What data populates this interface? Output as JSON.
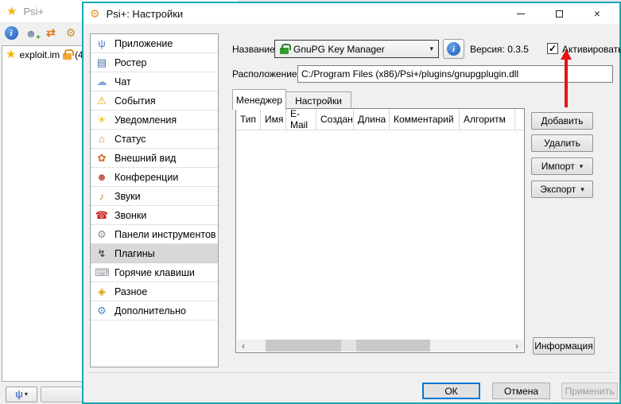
{
  "colors": {
    "dialog_border": "#15aab5",
    "focus_accent": "#0078d7",
    "annotation_arrow": "#e81414",
    "selection_bg": "#d8d8d8"
  },
  "background_window": {
    "title": "Psi+",
    "star_glyph": "★",
    "toolbar": {
      "info_glyph": "i",
      "add_contact_glyph": "☻",
      "transfer_glyph": "⇄",
      "wrench_glyph": "⚙"
    },
    "roster": {
      "star_glyph": "★",
      "account": "exploit.im",
      "suffix": "(4"
    },
    "status_button": {
      "psi_glyph": "ψ",
      "caret": "▾"
    }
  },
  "dialog": {
    "title": "Psi+: Настройки",
    "title_icon_glyph": "⚙",
    "sidebar": {
      "items": [
        {
          "label": "Приложение",
          "icon": "application-icon",
          "glyph": "ψ",
          "color": "#4f7bd9"
        },
        {
          "label": "Ростер",
          "icon": "roster-icon",
          "glyph": "▤",
          "color": "#4a6fa5"
        },
        {
          "label": "Чат",
          "icon": "chat-icon",
          "glyph": "☁",
          "color": "#79a8d8"
        },
        {
          "label": "События",
          "icon": "events-icon",
          "glyph": "⚠",
          "color": "#f0a000"
        },
        {
          "label": "Уведомления",
          "icon": "notifications-icon",
          "glyph": "☀",
          "color": "#f2c200"
        },
        {
          "label": "Статус",
          "icon": "status-icon",
          "glyph": "⌂",
          "color": "#e08050"
        },
        {
          "label": "Внешний вид",
          "icon": "appearance-icon",
          "glyph": "✿",
          "color": "#d86a28"
        },
        {
          "label": "Конференции",
          "icon": "conferences-icon",
          "glyph": "☻",
          "color": "#c05040"
        },
        {
          "label": "Звуки",
          "icon": "sounds-icon",
          "glyph": "♪",
          "color": "#c08a20"
        },
        {
          "label": "Звонки",
          "icon": "calls-icon",
          "glyph": "☎",
          "color": "#cc2020"
        },
        {
          "label": "Панели инструментов",
          "icon": "toolbars-icon",
          "glyph": "⚙",
          "color": "#8a9096"
        },
        {
          "label": "Плагины",
          "icon": "plugins-icon",
          "glyph": "↯",
          "color": "#303030",
          "selected": true
        },
        {
          "label": "Горячие клавиши",
          "icon": "shortcuts-icon",
          "glyph": "⌨",
          "color": "#9098a0"
        },
        {
          "label": "Разное",
          "icon": "misc-icon",
          "glyph": "◈",
          "color": "#e0a010"
        },
        {
          "label": "Дополнительно",
          "icon": "advanced-icon",
          "glyph": "⚙",
          "color": "#4a90d0"
        }
      ]
    },
    "plugin_bar": {
      "name_label": "Название:",
      "selected_plugin": "GnuPG Key Manager",
      "caret": "▾",
      "info_glyph": "i",
      "version_text": "Версия: 0.3.5",
      "checkmark": "✓",
      "activate_label": "Активировать",
      "location_label": "Расположение:",
      "location_value": "C:/Program Files (x86)/Psi+/plugins/gnupgplugin.dll"
    },
    "tabs": [
      {
        "label": "Менеджер",
        "active": true
      },
      {
        "label": "Настройки",
        "active": false
      }
    ],
    "key_table": {
      "columns": [
        "Тип",
        "Имя",
        "E-Mail",
        "Создан",
        "Длина",
        "Комментарий",
        "Алгоритм"
      ],
      "rows": []
    },
    "scrollbar": {
      "left_arrow": "‹",
      "right_arrow": "›"
    },
    "actions": [
      {
        "label": "Добавить",
        "caret": ""
      },
      {
        "label": "Удалить",
        "caret": ""
      },
      {
        "label": "Импорт",
        "caret": "▾"
      },
      {
        "label": "Экспорт",
        "caret": "▾"
      }
    ],
    "info_button_label": "Информация",
    "footer": {
      "ok": "ОК",
      "cancel": "Отмена",
      "apply": "Применить"
    }
  }
}
